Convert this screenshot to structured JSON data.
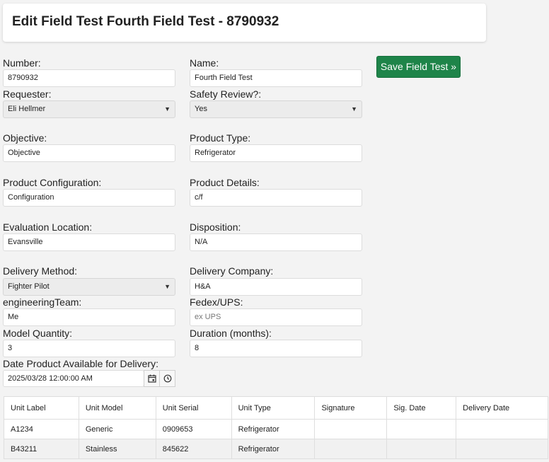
{
  "header": {
    "title": "Edit Field Test Fourth Field Test - 8790932"
  },
  "form": {
    "number": {
      "label": "Number:",
      "value": "8790932"
    },
    "name": {
      "label": "Name:",
      "value": "Fourth Field Test"
    },
    "requester": {
      "label": "Requester:",
      "value": "Eli Hellmer"
    },
    "safety_review": {
      "label": "Safety Review?:",
      "value": "Yes"
    },
    "objective": {
      "label": "Objective:",
      "value": "Objective"
    },
    "product_type": {
      "label": "Product Type:",
      "value": "Refrigerator"
    },
    "product_configuration": {
      "label": "Product Configuration:",
      "value": "Configuration"
    },
    "product_details": {
      "label": "Product Details:",
      "value": "c/f"
    },
    "evaluation_location": {
      "label": "Evaluation Location:",
      "value": "Evansville"
    },
    "disposition": {
      "label": "Disposition:",
      "value": "N/A"
    },
    "delivery_method": {
      "label": "Delivery Method:",
      "value": "Fighter Pilot"
    },
    "delivery_company": {
      "label": "Delivery Company:",
      "value": "H&A"
    },
    "engineering_team": {
      "label": "engineeringTeam:",
      "value": "Me"
    },
    "fedex_ups": {
      "label": "Fedex/UPS:",
      "placeholder": "ex UPS"
    },
    "model_quantity": {
      "label": "Model Quantity:",
      "value": "3"
    },
    "duration": {
      "label": "Duration (months):",
      "value": "8"
    },
    "available_date": {
      "label": "Date Product Available for Delivery:",
      "value": "2025/03/28 12:00:00 AM"
    }
  },
  "save_button": {
    "label": "Save Field Test »"
  },
  "units_table": {
    "headers": [
      "Unit Label",
      "Unit Model",
      "Unit Serial",
      "Unit Type",
      "Signature",
      "Sig. Date",
      "Delivery Date"
    ],
    "rows": [
      [
        "A1234",
        "Generic",
        "0909653",
        "Refrigerator",
        "",
        "",
        ""
      ],
      [
        "B43211",
        "Stainless",
        "845622",
        "Refrigerator",
        "",
        "",
        ""
      ]
    ]
  },
  "icons": {
    "calendar": "calendar-icon",
    "clock": "clock-icon",
    "select_arrow": "caret-down-icon"
  }
}
